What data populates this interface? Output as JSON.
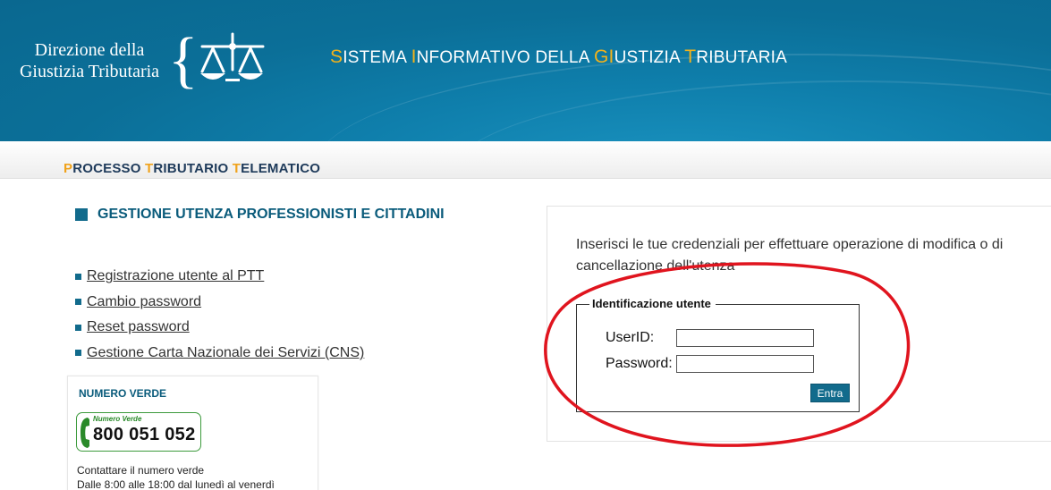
{
  "header": {
    "brand_line1": "Direzione della",
    "brand_line2": "Giustizia Tributaria",
    "system_title_parts": [
      {
        "cap": "S",
        "rest": "ISTEMA "
      },
      {
        "cap": "I",
        "rest": "NFORMATIVO DELLA "
      },
      {
        "cap": "GI",
        "rest": "USTIZIA "
      },
      {
        "cap": "T",
        "rest": "RIBUTARIA"
      }
    ],
    "logo_icon": "scales-of-justice-icon"
  },
  "subheader": {
    "title_parts": [
      {
        "cap": "P",
        "rest": "ROCESSO "
      },
      {
        "cap": "T",
        "rest": "RIBUTARIO "
      },
      {
        "cap": "T",
        "rest": "ELEMATICO"
      }
    ]
  },
  "left": {
    "section_title": "GESTIONE UTENZA PROFESSIONISTI E CITTADINI",
    "links": [
      "Registrazione utente al PTT",
      "Cambio password",
      "Reset password",
      "Gestione Carta Nazionale dei Servizi (CNS)"
    ],
    "numero_verde": {
      "title": "NUMERO VERDE",
      "badge_small": "Numero Verde",
      "number": "800 051 052",
      "line1": "Contattare il numero verde",
      "line2": "Dalle 8:00 alle 18:00 dal lunedì al venerdì"
    }
  },
  "right": {
    "intro": "Inserisci le tue credenziali per effettuare operazione di modifica o di cancellazione dell'utenza",
    "legend": "Identificazione utente",
    "userid_label": "UserID:",
    "password_label": "Password:",
    "userid_value": "",
    "password_value": "",
    "submit_label": "Entra"
  },
  "colors": {
    "banner": "#0b6f98",
    "accent_gold": "#f2b21b",
    "link_blue": "#0a5b7b",
    "button": "#126b8c",
    "annotation_red": "#e0141e"
  }
}
